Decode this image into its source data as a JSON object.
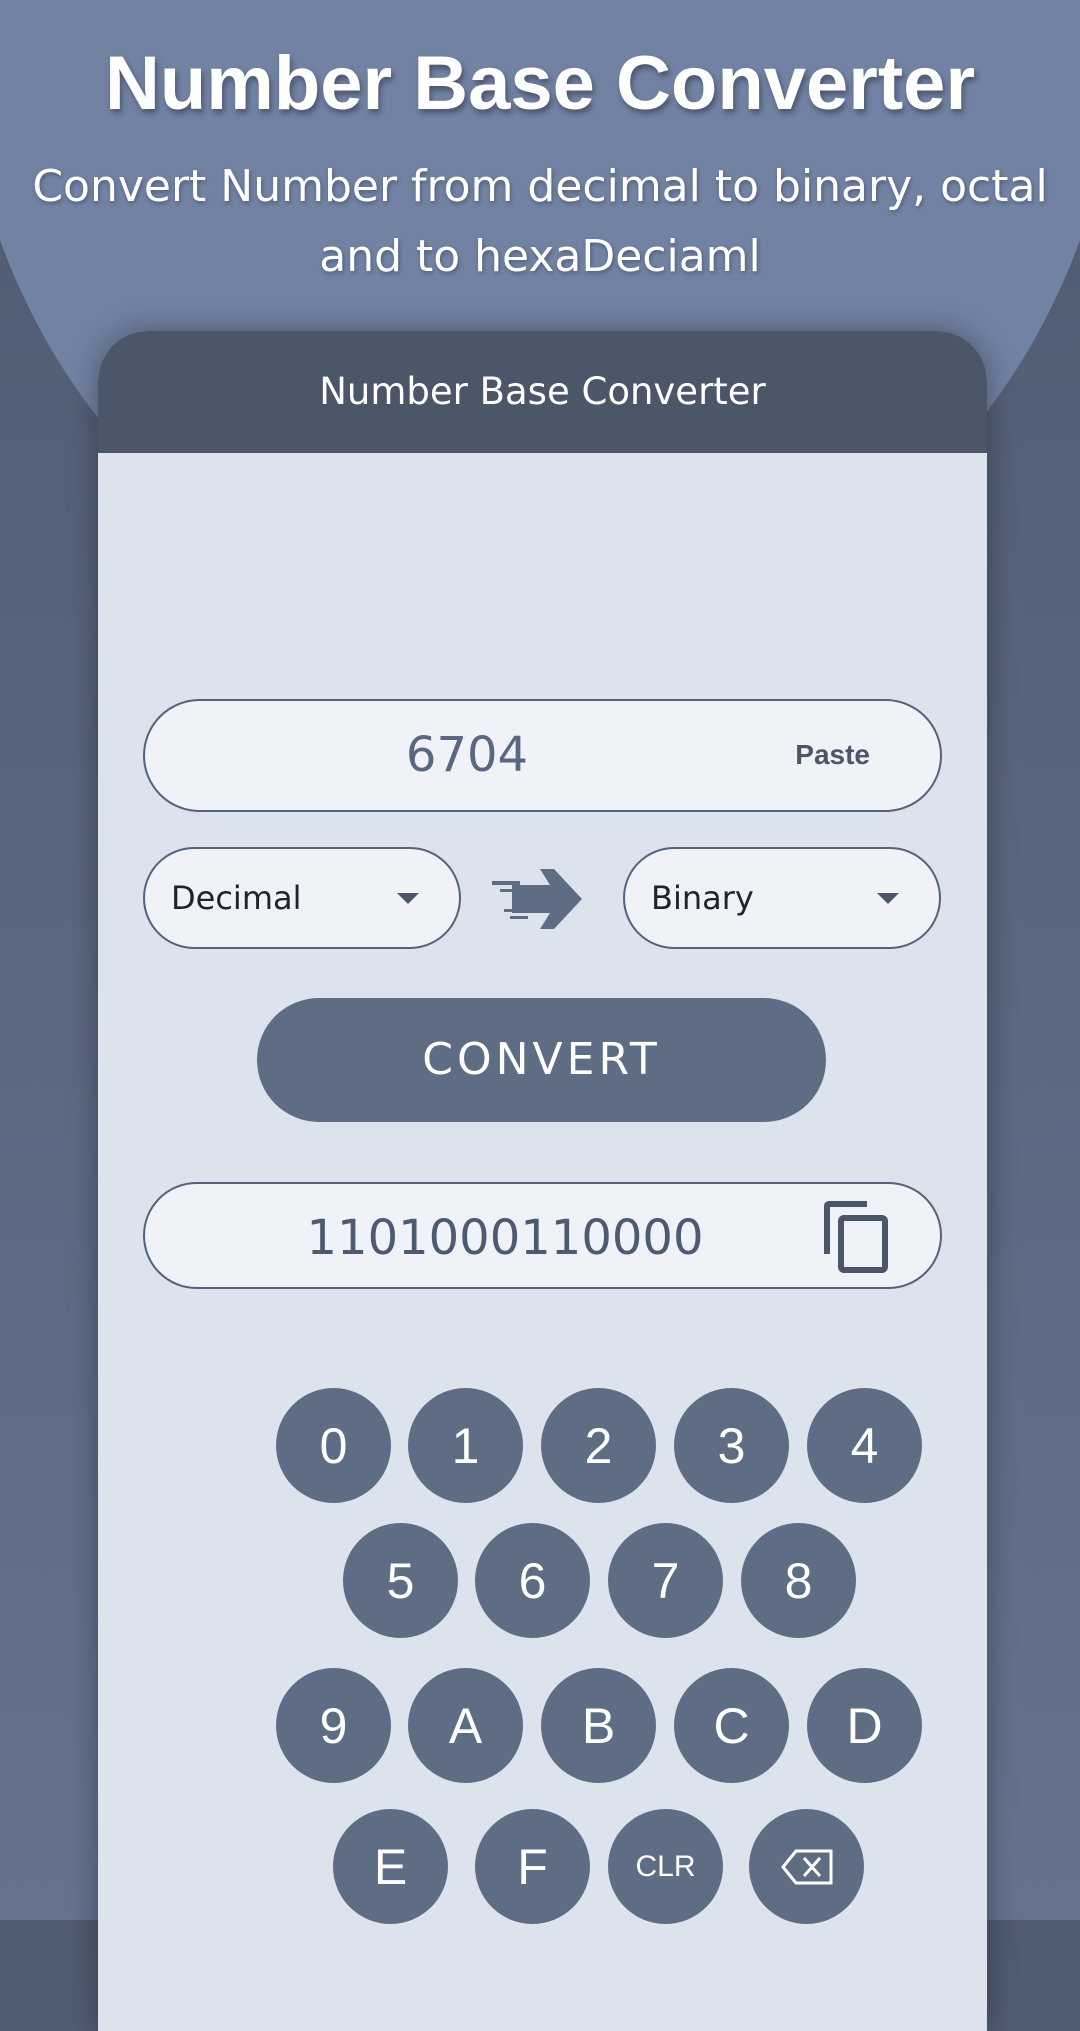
{
  "hero": {
    "title": "Number Base Converter",
    "subtitle_line1": "Convert Number from decimal to binary, octal",
    "subtitle_line2": "and to hexaDeciaml"
  },
  "app": {
    "title": "Number Base Converter",
    "input": {
      "value": "6704",
      "paste_label": "Paste"
    },
    "from_select": {
      "value": "Decimal"
    },
    "to_select": {
      "value": "Binary"
    },
    "convert_label": "CONVERT",
    "output": {
      "value": "1101000110000"
    },
    "keypad": [
      [
        "0",
        "1",
        "2",
        "3",
        "4"
      ],
      [
        "5",
        "6",
        "7",
        "8"
      ],
      [
        "9",
        "A",
        "B",
        "C",
        "D"
      ],
      [
        "E",
        "F",
        "CLR",
        "backspace-icon"
      ]
    ]
  },
  "colors": {
    "accent": "#5f6d84",
    "header": "#4b5669",
    "background": "#7282a3"
  }
}
